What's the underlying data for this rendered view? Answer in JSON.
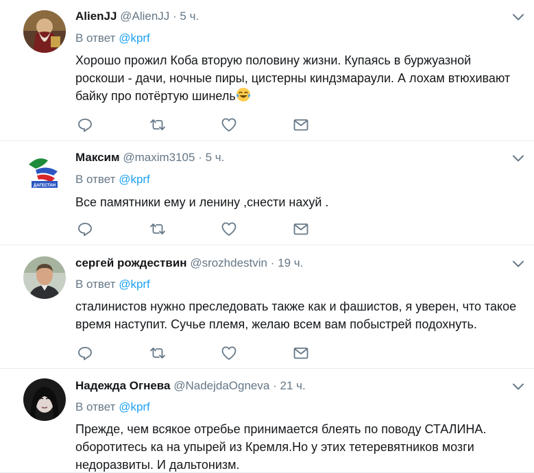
{
  "thread": {
    "tweets": [
      {
        "name": "AlienJJ",
        "handle": "@AlienJJ",
        "dot": "·",
        "time": "5 ч.",
        "reply_prefix": "В ответ",
        "reply_mention": "@kprf",
        "text": "Хорошо прожил Коба вторую половину жизни. Купаясь в буржуазной роскоши - дачи, ночные пиры, цистерны киндзмараули. А лохам втюхивают байку про потёртую шинель",
        "emoji": "face-with-tears-of-joy"
      },
      {
        "name": "Максим",
        "handle": "@maxim3105",
        "dot": "·",
        "time": "5 ч.",
        "reply_prefix": "В ответ",
        "reply_mention": "@kprf",
        "text": "Все памятники ему и ленину ,снести нахуй .",
        "avatar_caption": "ДАГЕСТАН"
      },
      {
        "name": "сергей рождествин",
        "handle": "@srozhdestvin",
        "dot": "·",
        "time": "19 ч.",
        "reply_prefix": "В ответ",
        "reply_mention": "@kprf",
        "text": "сталинистов нужно преследовать также как и фашистов, я уверен, что такое время наступит. Сучье племя, желаю всем вам побыстрей подохнуть."
      },
      {
        "name": "Надежда Огнева",
        "handle": "@NadejdaOgneva",
        "dot": "·",
        "time": "21 ч.",
        "reply_prefix": "В ответ",
        "reply_mention": "@kprf",
        "text": "Прежде, чем всякое отребье принимается блеять по поводу СТАЛИНА. оборотитесь ка на упырей из Кремля.Но у этих тетеревятников мозги недоразвиты. И дальтонизм."
      }
    ]
  },
  "icons": {
    "reply": "reply-icon",
    "retweet": "retweet-icon",
    "like": "like-icon",
    "dm": "direct-message-icon",
    "menu": "chevron-down-icon"
  },
  "colors": {
    "text": "#14171a",
    "secondary": "#657786",
    "link": "#1da1f2",
    "divider": "#e6ecf0"
  }
}
